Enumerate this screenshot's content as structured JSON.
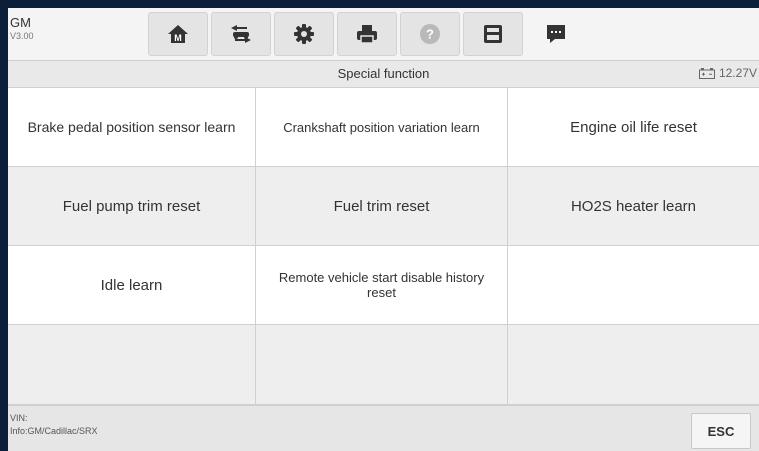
{
  "header": {
    "make": "GM",
    "version": "V3.00"
  },
  "toolbar": {
    "buttons": [
      {
        "icon": "home-icon"
      },
      {
        "icon": "vehicle-swap-icon"
      },
      {
        "icon": "gear-icon"
      },
      {
        "icon": "printer-icon"
      },
      {
        "icon": "help-icon"
      },
      {
        "icon": "save-icon"
      },
      {
        "icon": "message-icon"
      }
    ]
  },
  "titlebar": {
    "title": "Special function",
    "battery_voltage": "12.27V"
  },
  "functions": [
    {
      "label": "Brake pedal position sensor learn"
    },
    {
      "label": "Crankshaft position variation learn"
    },
    {
      "label": "Engine oil life reset"
    },
    {
      "label": "Fuel pump trim reset"
    },
    {
      "label": "Fuel trim reset"
    },
    {
      "label": "HO2S heater learn"
    },
    {
      "label": "Idle learn"
    },
    {
      "label": "Remote vehicle start disable history reset"
    },
    {
      "label": ""
    },
    {
      "label": ""
    },
    {
      "label": ""
    },
    {
      "label": ""
    }
  ],
  "footer": {
    "vin_label": "VIN:",
    "info": "Info:GM/Cadillac/SRX",
    "esc_label": "ESC"
  },
  "colors": {
    "frame": "#0b1f3a",
    "icon": "#333333"
  }
}
